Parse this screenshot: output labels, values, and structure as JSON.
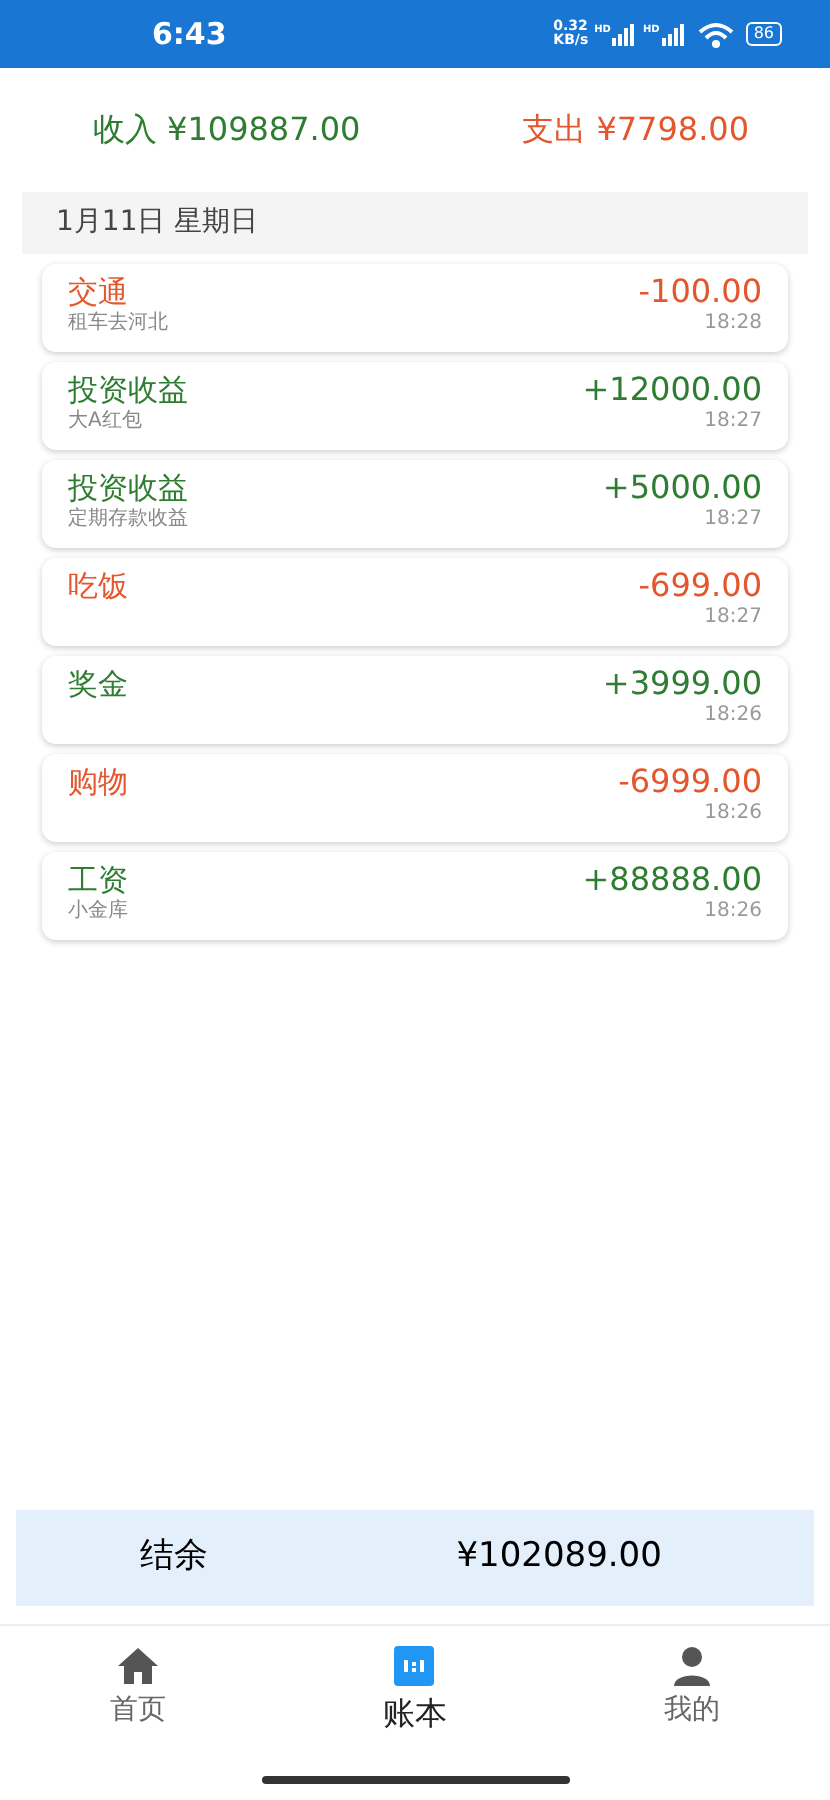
{
  "status_bar": {
    "time": "6:43",
    "speed_value": "0.32",
    "speed_unit": "KB/s",
    "sim_labels": [
      "HD",
      "HD"
    ],
    "battery": "86"
  },
  "summary": {
    "income_label": "收入 ¥109887.00",
    "expense_label": "支出 ¥7798.00"
  },
  "date_header": "1月11日 星期日",
  "records": [
    {
      "kind": "expense",
      "category": "交通",
      "note": "租车去河北",
      "amount": "-100.00",
      "time": "18:28"
    },
    {
      "kind": "income",
      "category": "投资收益",
      "note": "大A红包",
      "amount": "+12000.00",
      "time": "18:27"
    },
    {
      "kind": "income",
      "category": "投资收益",
      "note": "定期存款收益",
      "amount": "+5000.00",
      "time": "18:27"
    },
    {
      "kind": "expense",
      "category": "吃饭",
      "amount": "-699.00",
      "time": "18:27"
    },
    {
      "kind": "income",
      "category": "奖金",
      "amount": "+3999.00",
      "time": "18:26"
    },
    {
      "kind": "expense",
      "category": "购物",
      "amount": "-6999.00",
      "time": "18:26"
    },
    {
      "kind": "income",
      "category": "工资",
      "note": "小金库",
      "amount": "+88888.00",
      "time": "18:26"
    }
  ],
  "balance": {
    "label": "结余",
    "amount": "¥102089.00"
  },
  "tabs": [
    {
      "kind": "home",
      "label": "首页",
      "selected": false
    },
    {
      "kind": "ledger",
      "label": "账本",
      "selected": true
    },
    {
      "kind": "profile",
      "label": "我的",
      "selected": false
    }
  ]
}
